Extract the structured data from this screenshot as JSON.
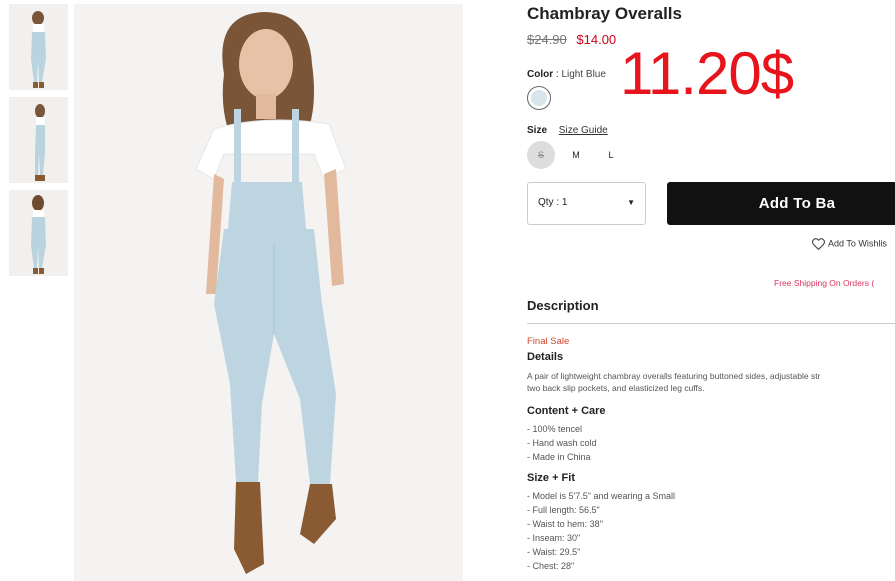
{
  "product": {
    "title": "Chambray Overalls",
    "old_price": "$24.90",
    "new_price": "$14.00",
    "overlay_price": "11.20$"
  },
  "color": {
    "label": "Color",
    "separator": ":",
    "value": "Light Blue",
    "swatch_hex": "#d7e6ec"
  },
  "size": {
    "label": "Size",
    "guide_link": "Size Guide",
    "options": [
      {
        "label": "S",
        "available": false
      },
      {
        "label": "M",
        "available": true
      },
      {
        "label": "L",
        "available": true
      }
    ]
  },
  "qty": {
    "label": "Qty : 1"
  },
  "add_button": "Add To Ba",
  "wishlist": "Add To Wishlis",
  "shipping_text": "Free Shipping On Orders (",
  "description": {
    "title": "Description",
    "final_sale": "Final Sale",
    "details_title": "Details",
    "details_line1": "A pair of lightweight chambray overalls featuring buttoned sides, adjustable str",
    "details_line2": "two back slip pockets, and elasticized leg cuffs.",
    "content_title": "Content + Care",
    "content_items": [
      "- 100% tencel",
      "- Hand wash cold",
      "- Made in China"
    ],
    "fit_title": "Size + Fit",
    "fit_items": [
      "- Model is 5'7.5\" and wearing a Small",
      "- Full length: 56.5\"",
      "- Waist to hem: 38\"",
      "- Inseam: 30\"",
      "- Waist: 29.5\"",
      "- Chest: 28\""
    ]
  },
  "colors": {
    "accent_red": "#d0021b",
    "overlay_red": "#e8141b",
    "button_black": "#111111",
    "shipping_pink": "#d9335f"
  }
}
